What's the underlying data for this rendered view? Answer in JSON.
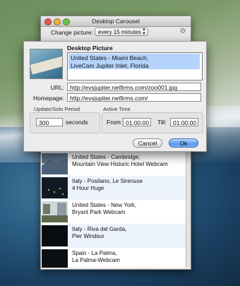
{
  "window": {
    "title": "Desktop Carousel",
    "change_picture_label": "Change picture:",
    "interval": "every 15 minutes"
  },
  "pictures": [
    {
      "title_line1": "United States - Cambridge,",
      "title_line2": "Mountain View Historic Hotel Webcam"
    },
    {
      "title_line1": "Italy - Positano, Le Sirenuse",
      "title_line2": "4 Hour Huge"
    },
    {
      "title_line1": "United States - New York,",
      "title_line2": "Bryant Park Webcam"
    },
    {
      "title_line1": "Italy - Riva del Garda,",
      "title_line2": "Pier Windsur"
    },
    {
      "title_line1": "Spain - La Palma,",
      "title_line2": "La Palma-Webcam"
    }
  ],
  "sheet": {
    "desktop_picture_label": "Desktop Picture",
    "description": "United States - Miami Beach,\nLiveCam Jupiter Inlet, Florida",
    "url_label": "URL:",
    "url_value": "http://evsjupiter.netfirms.com/zoo001.jpg",
    "homepage_label": "Homepage:",
    "homepage_value": "http://evsjupiter.netfirms.com/",
    "update_group_label": "Update/Solo Period",
    "update_value": "300",
    "seconds_label": "seconds",
    "active_group_label": "Active Time",
    "from_label": "From:",
    "from_value": "01:00:00",
    "till_label": "Till:",
    "till_value": "01:00:00",
    "cancel_label": "Cancel",
    "ok_label": "Ok"
  }
}
